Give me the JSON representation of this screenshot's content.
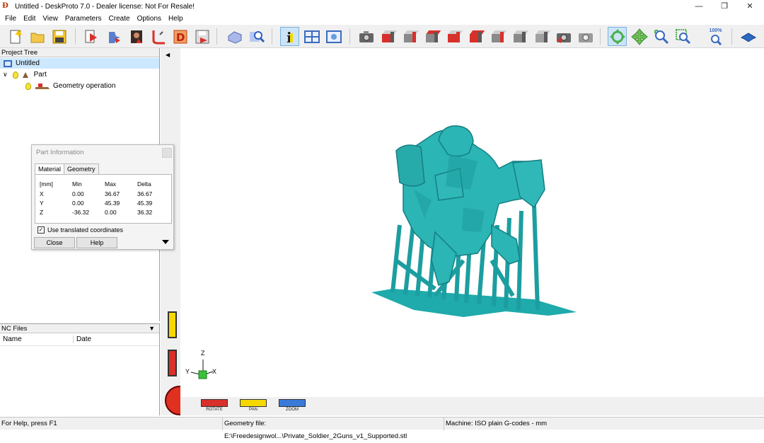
{
  "window": {
    "title": "Untitled - DeskProto 7.0 - Dealer license: Not For Resale!",
    "app_icon_text": "Ð"
  },
  "menu": [
    "File",
    "Edit",
    "View",
    "Parameters",
    "Create",
    "Options",
    "Help"
  ],
  "toolbar": {
    "zoom_100_label": "100%",
    "icons": [
      "new-file-icon",
      "open-folder-icon",
      "save-icon",
      "import-geometry-icon",
      "add-part-icon",
      "part-image-icon",
      "cut-icon",
      "create-d-icon",
      "save-nc-icon",
      "shape-icon",
      "magnify-icon",
      "info-icon",
      "window-split-icon",
      "view-window-icon",
      "camera-icon",
      "view-cube-front",
      "view-cube-back",
      "view-cube-left",
      "view-cube-right",
      "view-cube-top",
      "view-cube-bottom",
      "view-cube-iso",
      "view-cube-iso2",
      "camera-back-icon",
      "camera-settings-icon",
      "rotate-mode-icon",
      "pan-mode-icon",
      "zoom-in-icon",
      "zoom-window-icon",
      "zoom-100-icon",
      "book-help-icon"
    ]
  },
  "project_tree": {
    "header": "Project Tree",
    "root": "Untitled",
    "part": "Part",
    "operation": "Geometry operation"
  },
  "nc_files": {
    "header": "NC Files",
    "col_name": "Name",
    "col_date": "Date"
  },
  "dialog": {
    "title": "Part Information",
    "tabs": [
      "Material",
      "Geometry"
    ],
    "headers": [
      "[mm]",
      "Min",
      "Max",
      "Delta"
    ],
    "rows": [
      {
        "axis": "X",
        "min": "0.00",
        "max": "36.67",
        "delta": "36.67"
      },
      {
        "axis": "Y",
        "min": "0.00",
        "max": "45.39",
        "delta": "45.39"
      },
      {
        "axis": "Z",
        "min": "-36.32",
        "max": "0.00",
        "delta": "36.32"
      }
    ],
    "checkbox_label": "Use translated coordinates",
    "checkbox_checked": true,
    "close_label": "Close",
    "help_label": "Help"
  },
  "axes": {
    "z": "Z",
    "y": "Y",
    "x": "X"
  },
  "modes": {
    "rotate": "ROTATE",
    "pan": "PAN",
    "zoom": "ZOOM"
  },
  "status": {
    "help": "For Help, press F1",
    "geometry_file": "Geometry file: E:\\Freedesignwol...\\Private_Soldier_2Guns_v1_Supported.stl",
    "machine": "Machine: ISO plain G-codes - mm"
  },
  "colors": {
    "model": "#2bb5b5",
    "model_dark": "#157e82",
    "accent": "#cde4f7"
  }
}
